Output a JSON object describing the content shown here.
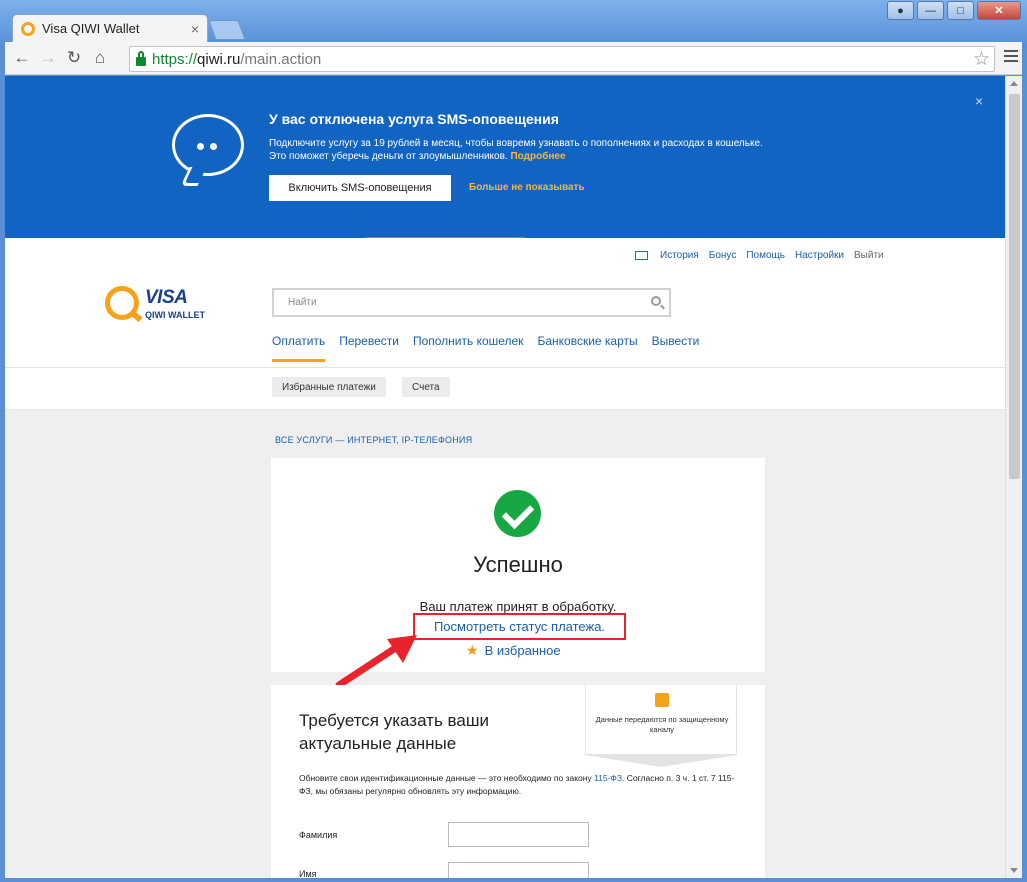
{
  "browser": {
    "tab_title": "Visa QIWI Wallet",
    "tab_close": "×",
    "url_scheme": "https://",
    "url_host": "qiwi.ru",
    "url_path": "/main.action",
    "win_close": "✕",
    "win_max": "□",
    "win_min": "—"
  },
  "banner": {
    "title": "У вас отключена услуга SMS-оповещения",
    "line1": "Подключите услугу за 19 рублей в месяц, чтобы вовремя узнавать о пополнениях и расходах в кошельке.",
    "line2": "Это поможет уберечь деньги от злоумышленников.",
    "more_link": "Подробнее",
    "enable_button": "Включить SMS-оповещения",
    "hide_link": "Больше не показывать",
    "close": "×"
  },
  "header": {
    "links": [
      "История",
      "Бонус",
      "Помощь",
      "Настройки",
      "Выйти"
    ],
    "logo_visa": "VISA",
    "logo_wallet": "QIWI WALLET",
    "search_placeholder": "Найти",
    "nav": [
      "Оплатить",
      "Перевести",
      "Пополнить кошелек",
      "Банковские карты",
      "Вывести"
    ],
    "subnav": [
      "Избранные платежи",
      "Счета"
    ]
  },
  "breadcrumb": "ВСЕ УСЛУГИ — ИНТЕРНЕТ, IP-ТЕЛЕФОНИЯ",
  "success": {
    "title": "Успешно",
    "text": "Ваш платеж принят в обработку.",
    "status_link": "Посмотреть статус платежа.",
    "favorites": "В избранное"
  },
  "update_form": {
    "title": "Требуется указать ваши актуальные данные",
    "secure_text": "Данные передаются по защищенному каналу",
    "info_part1": "Обновите свои идентификационные данные — это необходимо по закону ",
    "info_law": "115-ФЗ",
    "info_part2": ". Согласно п. 3 ч. 1 ст. 7 115-ФЗ, мы обязаны регулярно обновлять эту информацию.",
    "fields": [
      "Фамилия",
      "Имя"
    ]
  },
  "colors": {
    "banner_bg": "#1264c2",
    "accent_orange": "#f7a21b",
    "link_blue": "#1a5fa8",
    "success_green": "#18a843",
    "highlight_red": "#e8232c"
  }
}
